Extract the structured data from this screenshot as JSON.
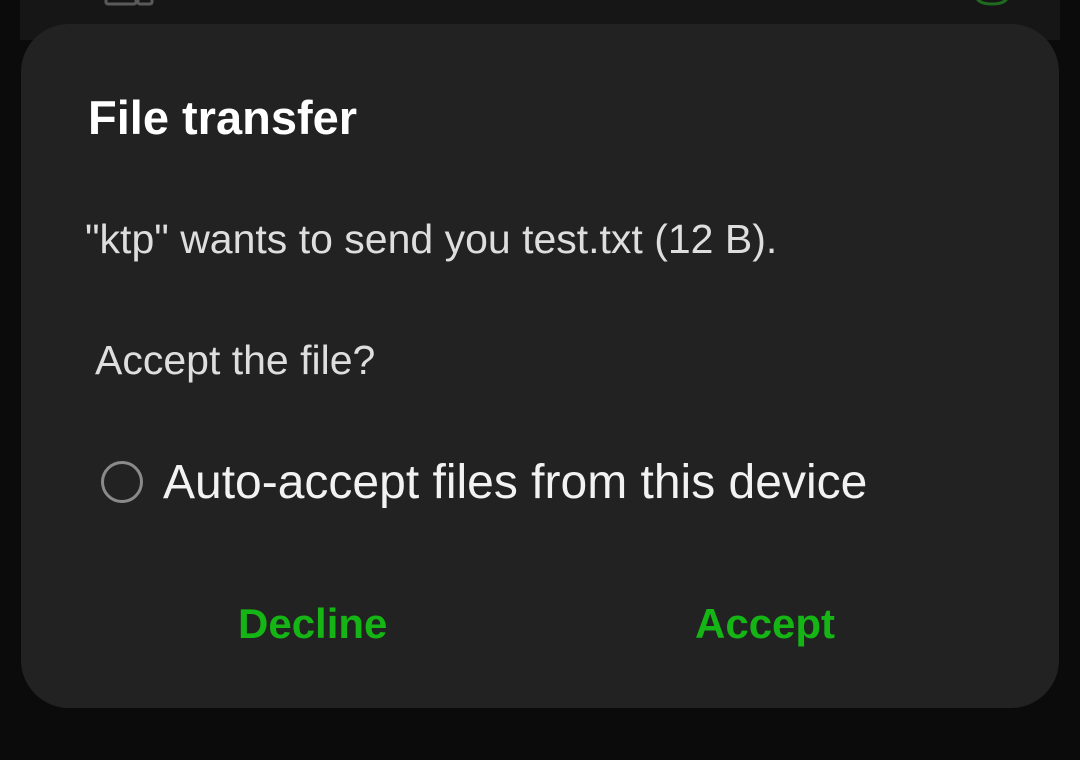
{
  "background": {
    "left_icon": "desktop-icon",
    "right_icon": "android-icon"
  },
  "dialog": {
    "title": "File transfer",
    "message": "\"ktp\" wants to send you test.txt (12 B).",
    "question": "Accept the file?",
    "auto_accept": {
      "label": "Auto-accept files from this device",
      "checked": false
    },
    "buttons": {
      "decline": "Decline",
      "accept": "Accept"
    }
  },
  "colors": {
    "dialog_bg": "#222222",
    "accent": "#14b514",
    "title": "#ffffff",
    "body_text": "#dedede"
  }
}
